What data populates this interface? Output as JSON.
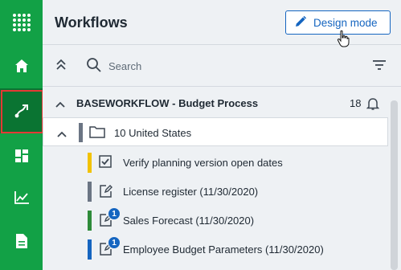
{
  "rail": {
    "items": [
      {
        "name": "apps-grid",
        "icon": "apps-grid-icon"
      },
      {
        "name": "home",
        "icon": "home-icon"
      },
      {
        "name": "workflows",
        "icon": "workflow-route-icon",
        "active": true
      },
      {
        "name": "dashboards",
        "icon": "dashboard-icon"
      },
      {
        "name": "analytics",
        "icon": "chart-line-icon"
      },
      {
        "name": "documents",
        "icon": "document-icon"
      }
    ],
    "color": "#12a146",
    "active_color": "#0a7432"
  },
  "header": {
    "title": "Workflows",
    "design_mode_label": "Design mode"
  },
  "toolbar": {
    "search_placeholder": "Search"
  },
  "group": {
    "title": "BASEWORKFLOW - Budget Process",
    "count": "18"
  },
  "folder": {
    "label": "10 United States",
    "bar_color": "#6b7584"
  },
  "tasks": [
    {
      "label": "Verify planning version open dates",
      "icon": "checkbox-checked-icon",
      "bar_color": "#f2c200",
      "badge": ""
    },
    {
      "label": "License register (11/30/2020)",
      "icon": "edit-document-icon",
      "bar_color": "#6b7584",
      "badge": ""
    },
    {
      "label": "Sales Forecast (11/30/2020)",
      "icon": "edit-document-icon",
      "bar_color": "#2e8b3a",
      "badge": "1"
    },
    {
      "label": "Employee Budget Parameters (11/30/2020)",
      "icon": "edit-document-icon",
      "bar_color": "#1565c0",
      "badge": "1"
    }
  ]
}
